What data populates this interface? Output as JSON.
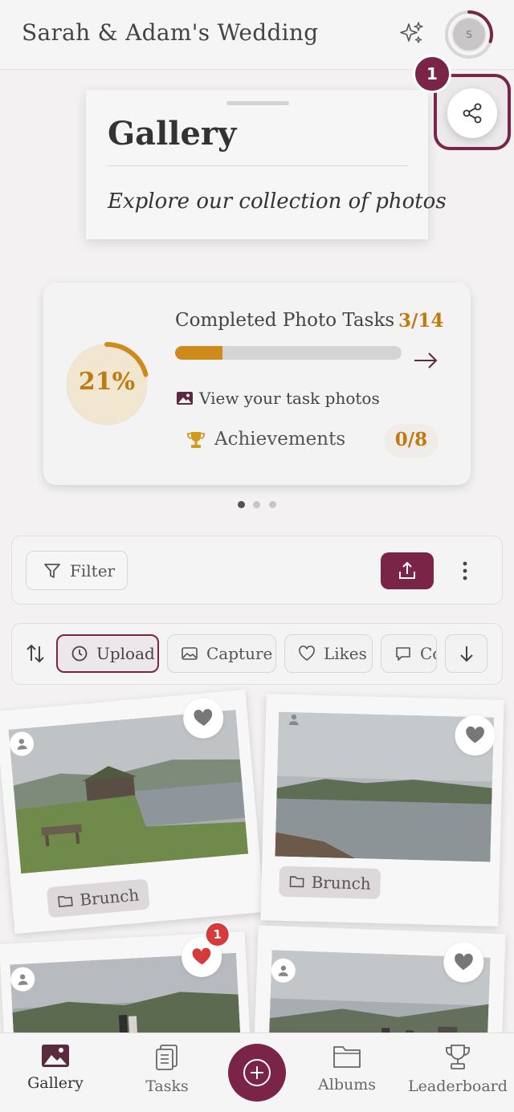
{
  "header": {
    "title": "Sarah & Adam's Wedding",
    "sparkle_icon": "sparkle-icon",
    "avatar_initial": "S",
    "avatar_progress": 0.3
  },
  "gallery_card": {
    "title": "Gallery",
    "subtitle": "Explore our collection of photos"
  },
  "tour": {
    "step_number": "1",
    "highlight": "share-button"
  },
  "progress_card": {
    "percent_label": "21%",
    "percent": 0.21,
    "tasks_label": "Completed Photo Tasks",
    "tasks_count": "3/14",
    "tasks_progress": 0.21,
    "view_photos_label": "View your task photos",
    "achievements_label": "Achievements",
    "achievements_count": "0/8",
    "page_dots": 3,
    "active_dot": 0
  },
  "filter_bar": {
    "filter_label": "Filter"
  },
  "sort_bar": {
    "chips": [
      {
        "label": "Upload",
        "icon": "clock-icon",
        "active": true
      },
      {
        "label": "Capture",
        "icon": "image-icon",
        "active": false
      },
      {
        "label": "Likes",
        "icon": "heart-icon",
        "active": false
      },
      {
        "label": "Comments",
        "icon": "comment-icon",
        "active": false
      }
    ]
  },
  "photos": [
    {
      "album": "Brunch",
      "liked": false,
      "likes": ""
    },
    {
      "album": "Brunch",
      "liked": false,
      "likes": ""
    },
    {
      "album": "",
      "liked": true,
      "likes": "1"
    },
    {
      "album": "",
      "liked": false,
      "likes": ""
    }
  ],
  "bottom_nav": {
    "items": [
      {
        "label": "Gallery",
        "icon": "gallery-icon",
        "active": true
      },
      {
        "label": "Tasks",
        "icon": "tasks-icon",
        "active": false
      },
      {
        "label": "Albums",
        "icon": "folder-icon",
        "active": false
      },
      {
        "label": "Leaderboard",
        "icon": "trophy-icon",
        "active": false
      }
    ]
  },
  "colors": {
    "brand": "#7a2548",
    "accent": "#c17a10",
    "like": "#d63a3a"
  }
}
